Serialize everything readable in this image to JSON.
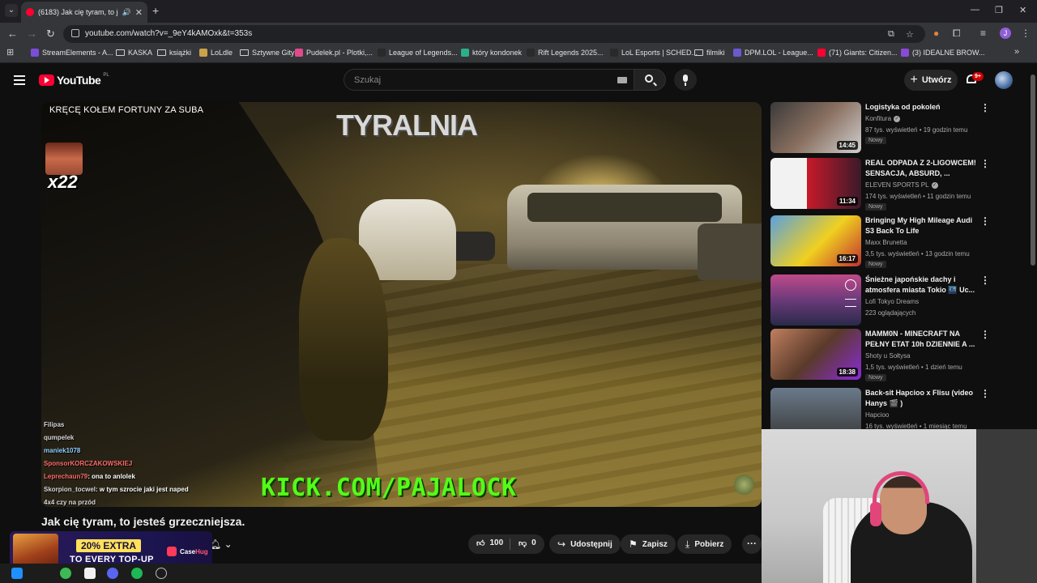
{
  "browser": {
    "tab_title": "(6183) Jak cię tyram, to jesteś",
    "url": "youtube.com/watch?v=_9eY4kAMOxk&t=353s",
    "bookmarks": [
      {
        "label": "StreamElements - A...",
        "color": "#7a4ed8"
      },
      {
        "label": "KASKA",
        "folder": true
      },
      {
        "label": "książki",
        "folder": true
      },
      {
        "label": "LoLdle",
        "color": "#c9a34a"
      },
      {
        "label": "Sztywne Gity",
        "folder": true
      },
      {
        "label": "Pudelek.pl - Plotki,...",
        "color": "#e04a8a"
      },
      {
        "label": "League of Legends...",
        "color": "#2a2a2a"
      },
      {
        "label": "który kondonek",
        "color": "#2ab08a"
      },
      {
        "label": "Rift Legends 2025...",
        "color": "#2a2a2a"
      },
      {
        "label": "LoL Esports | SCHED...",
        "color": "#2a2a2a"
      },
      {
        "label": "filmiki",
        "folder": true
      },
      {
        "label": "DPM.LOL - League...",
        "color": "#6a5acd"
      },
      {
        "label": "(71) Giants: Citizen...",
        "color": "#ff0033"
      },
      {
        "label": "(3) IDEALNE BROW...",
        "color": "#8a4ad8"
      }
    ],
    "profile_initial": "J",
    "colors": {
      "accent": "#ff0033"
    }
  },
  "yt": {
    "logo_text": "YouTube",
    "logo_region": "PL",
    "search_placeholder": "Szukaj",
    "create_label": "Utwórz",
    "notif_count": "9+"
  },
  "video": {
    "overlay_top": "KRĘCĘ KOŁEM FORTUNY ZA SUBA",
    "counter": "x22",
    "watermark": "TYRALNIA",
    "kick_text": "KICK.COM/PAJALOCK",
    "chat": [
      {
        "user": "Filipas",
        "msg": "",
        "cls": "u1"
      },
      {
        "user": "qumpelek",
        "msg": "",
        "cls": "u1"
      },
      {
        "user": "maniek1078",
        "msg": "",
        "cls": "u2"
      },
      {
        "user": "SponsorKORCZAKOWSKIEJ",
        "msg": "",
        "cls": "u3"
      },
      {
        "user": "Leprechaun79",
        "msg": ": ona to anlolek",
        "cls": "u3"
      },
      {
        "user": "Skorpion_tocwel",
        "msg": ": w tym szrocie jaki jest naped",
        "cls": "u1"
      },
      {
        "user": "4x4 czy na przód",
        "msg": "",
        "cls": "u1"
      }
    ],
    "title": "Jak cię tyram, to jesteś grzeczniejsza.",
    "likes": "100",
    "dislikes": "0",
    "share_label": "Udostępnij",
    "save_label": "Zapisz",
    "download_label": "Pobierz"
  },
  "ad": {
    "percent": "20% EXTRA",
    "sub": "TO EVERY TOP-UP",
    "brand_a": "Case",
    "brand_b": "Hug"
  },
  "recommended": [
    {
      "title": "Logistyka od pokoleń",
      "channel": "Konfitura",
      "verified": true,
      "meta": "87 tys. wyświetleń • 19 godzin temu",
      "badge": "Nowy",
      "duration": "14:45",
      "thumb": "linear-gradient(135deg,#3a3a3a,#8a7060 50%,#d0d0d0)"
    },
    {
      "title": "REAL ODPADA Z 2-LIGOWCEM! SENSACJA, ABSURD, ...",
      "channel": "ELEVEN SPORTS PL",
      "verified": true,
      "meta": "174 tys. wyświetleń • 11 godzin temu",
      "badge": "Nowy",
      "duration": "11:34",
      "thumb": "linear-gradient(90deg,#f2f2f2 0 40%,#c81a2a 40%,#3a1a2a)"
    },
    {
      "title": "Bringing My High Mileage Audi S3 Back To Life",
      "channel": "Maxx Brunetta",
      "verified": false,
      "meta": "3,5 tys. wyświetleń • 13 godzin temu",
      "badge": "Nowy",
      "duration": "16:17",
      "thumb": "linear-gradient(135deg,#5aa0e0,#f0d020 55%,#c03030)"
    },
    {
      "title": "Śnieżne japońskie dachy i atmosfera miasta Tokio 🌃 Uc...",
      "channel": "Lofi Tokyo Dreams",
      "verified": false,
      "meta": "223 oglądających",
      "badge": "",
      "duration": "",
      "thumb": "linear-gradient(180deg,#c04a8a,#6a3a7a 50%,#2a2a4a)"
    },
    {
      "title": "MAMM0N - MINECRAFT NA PEŁNY ETAT 10h DZIENNIE A ...",
      "channel": "Shoty u Sołtysa",
      "verified": false,
      "meta": "1,5 tys. wyświetleń • 1 dzień temu",
      "badge": "Nowy",
      "duration": "18:38",
      "thumb": "linear-gradient(135deg,#c08060,#5a3a2a 50%,#8a2ad8)"
    },
    {
      "title": "Back-sit Hapcioo x Flisu (video Hanys 🎬 )",
      "channel": "Hapcioo",
      "verified": false,
      "meta": "16 tys. wyświetleń • 1 miesiąc temu",
      "badge": "",
      "duration": "",
      "thumb": "linear-gradient(180deg,#6a7a8a,#3a3a3a)"
    }
  ]
}
